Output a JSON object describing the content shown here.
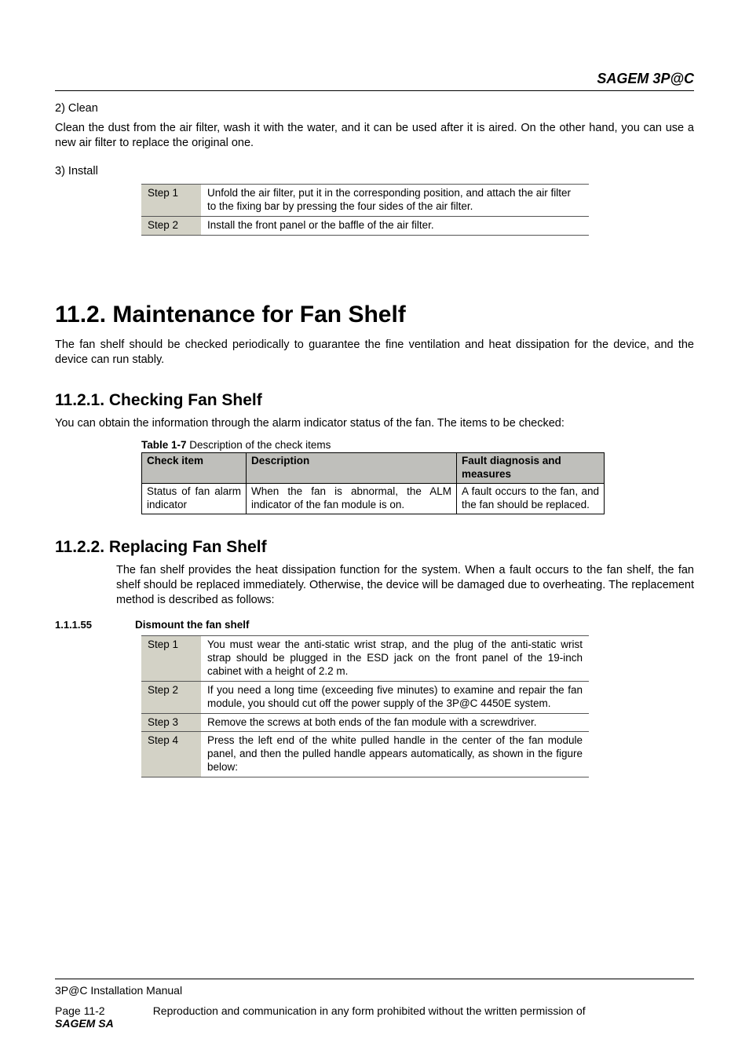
{
  "header": {
    "brand": "SAGEM 3P@C"
  },
  "intro": {
    "cleanTitle": "2) Clean",
    "cleanText": "Clean the dust from the air filter, wash it with the water, and it can be used after it is aired. On the other hand, you can use a new air filter to replace the original one.",
    "installTitle": "3) Install"
  },
  "installSteps": {
    "rows": [
      {
        "label": "Step 1",
        "text": "Unfold the air filter, put it in the corresponding position, and attach the air filter to the fixing bar by pressing the four sides of the air filter."
      },
      {
        "label": "Step 2",
        "text": "Install the front panel or the baffle of the air filter."
      }
    ]
  },
  "section112": {
    "title": "11.2. Maintenance for Fan Shelf",
    "intro": "The fan shelf should be checked periodically to guarantee the fine ventilation and heat dissipation for the device, and the device can run stably."
  },
  "section1121": {
    "title": "11.2.1. Checking Fan Shelf",
    "intro": "You can obtain the information through the alarm indicator status of the fan. The items to be checked:",
    "tableCaptionBold": "Table 1-7",
    "tableCaptionRest": " Description of the check items",
    "headers": {
      "c1": "Check item",
      "c2": "Description",
      "c3": "Fault diagnosis and measures"
    },
    "row": {
      "c1": "Status of fan alarm indicator",
      "c2": "When the fan is abnormal, the ALM indicator of the fan module is on.",
      "c3": "A fault occurs to the fan, and the fan should be replaced."
    }
  },
  "section1122": {
    "title": "11.2.2. Replacing Fan Shelf",
    "intro": "The fan shelf provides the heat dissipation function for the system. When a fault occurs to the fan shelf, the fan shelf should be replaced immediately. Otherwise, the device will be damaged due to overheating. The replacement method is described as follows:",
    "numbered": {
      "num": "1.1.1.55",
      "title": "Dismount the fan shelf"
    },
    "steps": [
      {
        "label": "Step 1",
        "text": "You must wear the anti-static wrist strap, and the plug of the anti-static wrist strap should be plugged in the ESD jack on the front panel of the 19-inch cabinet with a height of 2.2 m."
      },
      {
        "label": "Step 2",
        "text": "If you need a long time (exceeding five minutes) to examine and repair the fan module, you should cut off the power supply of the 3P@C 4450E system."
      },
      {
        "label": "Step 3",
        "text": "Remove the screws at both ends of the fan module with a screwdriver."
      },
      {
        "label": "Step 4",
        "text": "Press the left end of the white pulled handle in the center of the fan module panel, and then the pulled handle appears automatically, as shown in the figure below:"
      }
    ]
  },
  "footer": {
    "manual": "3P@C Installation Manual",
    "page": "Page 11-2",
    "rights": "Reproduction and communication in any form prohibited without the written permission of ",
    "company": "SAGEM SA"
  }
}
